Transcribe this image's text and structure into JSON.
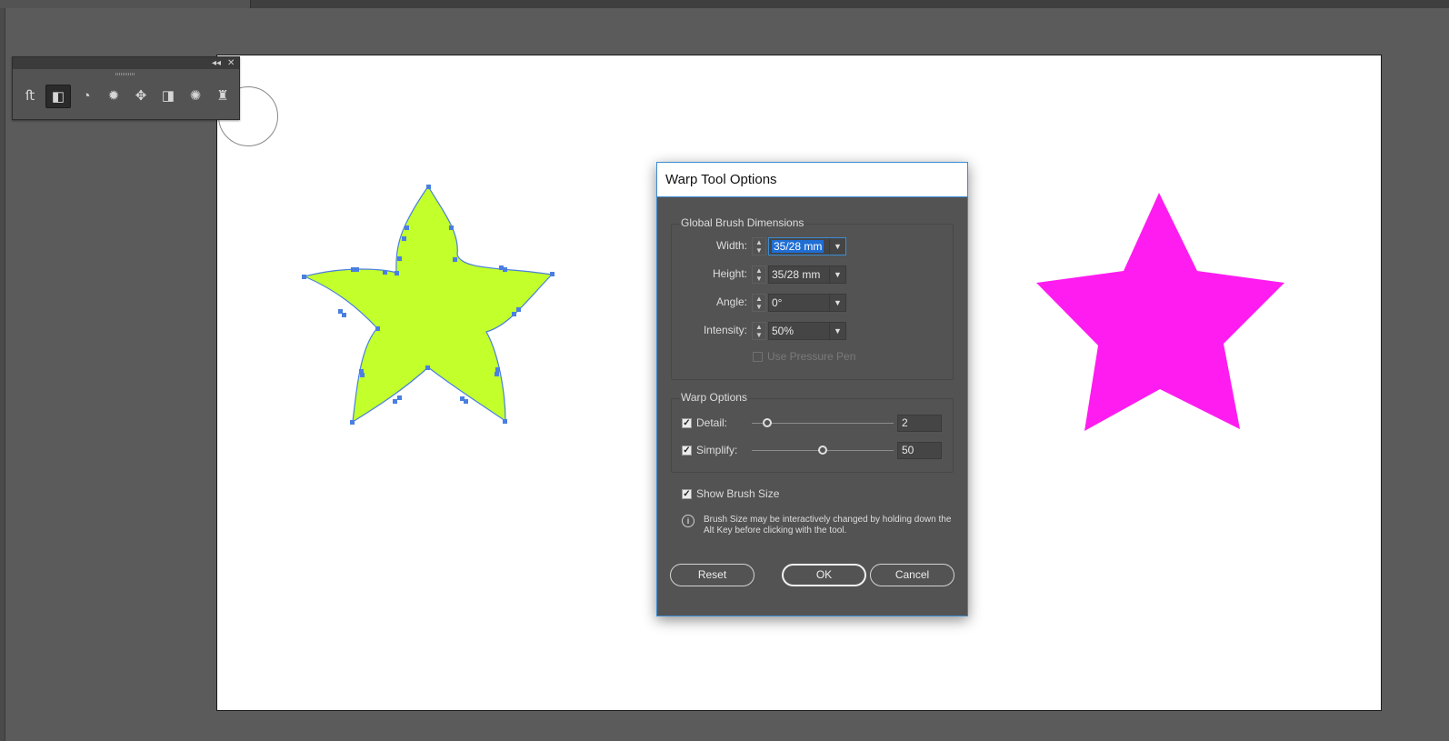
{
  "dialog": {
    "title": "Warp Tool Options",
    "global_brush_group": "Global Brush Dimensions",
    "width_label": "Width:",
    "width_value": "35/28 mm",
    "height_label": "Height:",
    "height_value": "35/28 mm",
    "angle_label": "Angle:",
    "angle_value": "0°",
    "intensity_label": "Intensity:",
    "intensity_value": "50%",
    "use_pressure_pen_label": "Use Pressure Pen",
    "warp_options_group": "Warp Options",
    "detail_label": "Detail:",
    "detail_value": "2",
    "detail_checked": true,
    "simplify_label": "Simplify:",
    "simplify_value": "50",
    "simplify_checked": true,
    "show_brush_size_label": "Show Brush Size",
    "show_brush_size_checked": true,
    "info_text": "Brush Size may be interactively changed by holding down the Alt Key before clicking with the tool.",
    "reset_label": "Reset",
    "ok_label": "OK",
    "cancel_label": "Cancel"
  },
  "tool_panel": {
    "tools": [
      "width-tool-icon",
      "warp-tool-icon",
      "twirl-tool-icon",
      "pucker-tool-icon",
      "bloat-tool-icon",
      "scallop-tool-icon",
      "crystallize-tool-icon",
      "wrinkle-tool-icon"
    ],
    "active_tool": "warp-tool-icon"
  },
  "colors": {
    "warped_star_fill": "#c2ff2b",
    "path_stroke": "#4a7fe0",
    "magenta_star_fill": "#ff1cf0",
    "accent": "#3c8cd3"
  }
}
